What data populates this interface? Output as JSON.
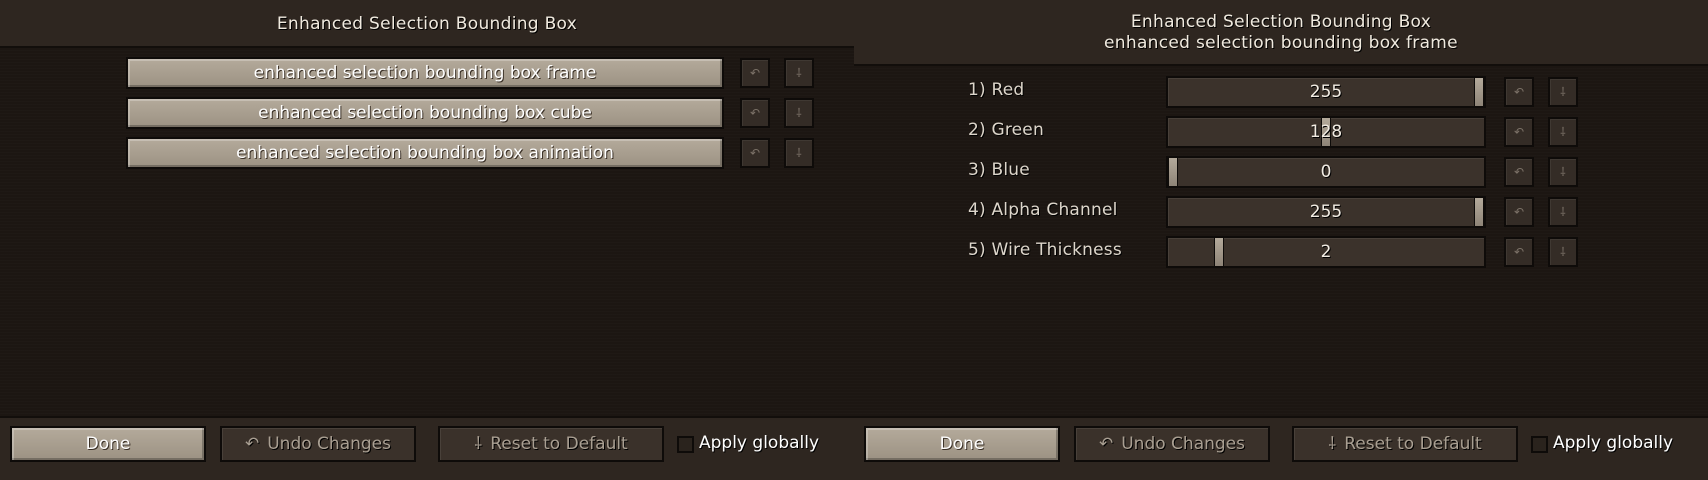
{
  "left": {
    "title": "Enhanced Selection Bounding Box",
    "entries": [
      {
        "label": "enhanced selection bounding box frame"
      },
      {
        "label": "enhanced selection bounding box cube"
      },
      {
        "label": "enhanced selection bounding box animation"
      }
    ],
    "footer": {
      "done": "Done",
      "undo": "Undo Changes",
      "reset": "Reset to Default",
      "apply": "Apply globally"
    }
  },
  "right": {
    "title": "Enhanced Selection Bounding Box",
    "subtitle": "enhanced selection bounding box frame",
    "settings": [
      {
        "label": "1) Red",
        "value": "255",
        "fraction": 1.0
      },
      {
        "label": "2) Green",
        "value": "128",
        "fraction": 0.5
      },
      {
        "label": "3) Blue",
        "value": "0",
        "fraction": 0.0
      },
      {
        "label": "4) Alpha Channel",
        "value": "255",
        "fraction": 1.0
      },
      {
        "label": "5) Wire Thickness",
        "value": "2",
        "fraction": 0.15
      }
    ],
    "footer": {
      "done": "Done",
      "undo": "Undo Changes",
      "reset": "Reset to Default",
      "apply": "Apply globally"
    }
  },
  "icons": {
    "undo": "↶",
    "reset": "⸸"
  },
  "colors": {
    "button_face": "#b4aa9b",
    "background": "#1c1612",
    "bar": "#2e2620"
  }
}
